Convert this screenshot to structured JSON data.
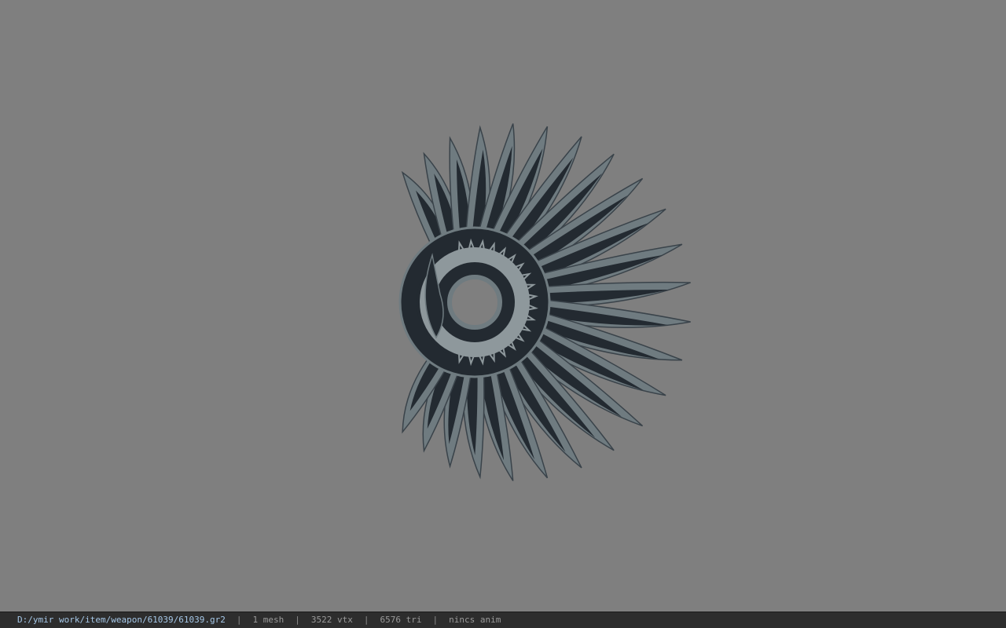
{
  "viewer": {
    "background_color": "#7f7f7f",
    "model_colors": {
      "feather_light": "#6f7b80",
      "feather_dark": "#232a31",
      "feather_edge": "#3a434a",
      "core_light": "#8e989c"
    }
  },
  "statusbar": {
    "file_path": "D:/ymir work/item/weapon/61039/61039.gr2",
    "separator": "|",
    "mesh_count": "1 mesh",
    "vertex_count": "3522 vtx",
    "triangle_count": "6576 tri",
    "animation_status": "nincs anim"
  }
}
